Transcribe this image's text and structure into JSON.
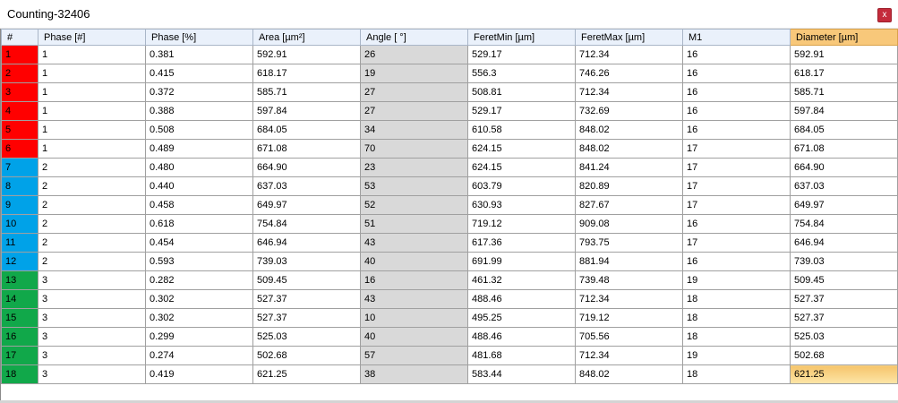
{
  "window": {
    "title": "Counting-32406",
    "close_label": "x"
  },
  "colors": {
    "phase1": "#ff0000",
    "phase2": "#00a2e8",
    "phase3": "#11a84a",
    "angle_column": "#d9d9d9",
    "highlight_header": "#f8c87a"
  },
  "table": {
    "headers": [
      "#",
      "Phase [#]",
      "Phase [%]",
      "Area [µm²]",
      "Angle [ °]",
      "FeretMin [µm]",
      "FeretMax [µm]",
      "M1",
      "Diameter [µm]"
    ],
    "highlighted_column": 8,
    "selected_row": 17,
    "rows": [
      [
        "1",
        "1",
        "0.381",
        "592.91",
        "26",
        "529.17",
        "712.34",
        "16",
        "592.91"
      ],
      [
        "2",
        "1",
        "0.415",
        "618.17",
        "19",
        "556.3",
        "746.26",
        "16",
        "618.17"
      ],
      [
        "3",
        "1",
        "0.372",
        "585.71",
        "27",
        "508.81",
        "712.34",
        "16",
        "585.71"
      ],
      [
        "4",
        "1",
        "0.388",
        "597.84",
        "27",
        "529.17",
        "732.69",
        "16",
        "597.84"
      ],
      [
        "5",
        "1",
        "0.508",
        "684.05",
        "34",
        "610.58",
        "848.02",
        "16",
        "684.05"
      ],
      [
        "6",
        "1",
        "0.489",
        "671.08",
        "70",
        "624.15",
        "848.02",
        "17",
        "671.08"
      ],
      [
        "7",
        "2",
        "0.480",
        "664.90",
        "23",
        "624.15",
        "841.24",
        "17",
        "664.90"
      ],
      [
        "8",
        "2",
        "0.440",
        "637.03",
        "53",
        "603.79",
        "820.89",
        "17",
        "637.03"
      ],
      [
        "9",
        "2",
        "0.458",
        "649.97",
        "52",
        "630.93",
        "827.67",
        "17",
        "649.97"
      ],
      [
        "10",
        "2",
        "0.618",
        "754.84",
        "51",
        "719.12",
        "909.08",
        "16",
        "754.84"
      ],
      [
        "11",
        "2",
        "0.454",
        "646.94",
        "43",
        "617.36",
        "793.75",
        "17",
        "646.94"
      ],
      [
        "12",
        "2",
        "0.593",
        "739.03",
        "40",
        "691.99",
        "881.94",
        "16",
        "739.03"
      ],
      [
        "13",
        "3",
        "0.282",
        "509.45",
        "16",
        "461.32",
        "739.48",
        "19",
        "509.45"
      ],
      [
        "14",
        "3",
        "0.302",
        "527.37",
        "43",
        "488.46",
        "712.34",
        "18",
        "527.37"
      ],
      [
        "15",
        "3",
        "0.302",
        "527.37",
        "10",
        "495.25",
        "719.12",
        "18",
        "527.37"
      ],
      [
        "16",
        "3",
        "0.299",
        "525.03",
        "40",
        "488.46",
        "705.56",
        "18",
        "525.03"
      ],
      [
        "17",
        "3",
        "0.274",
        "502.68",
        "57",
        "481.68",
        "712.34",
        "19",
        "502.68"
      ],
      [
        "18",
        "3",
        "0.419",
        "621.25",
        "38",
        "583.44",
        "848.02",
        "18",
        "621.25"
      ]
    ]
  }
}
